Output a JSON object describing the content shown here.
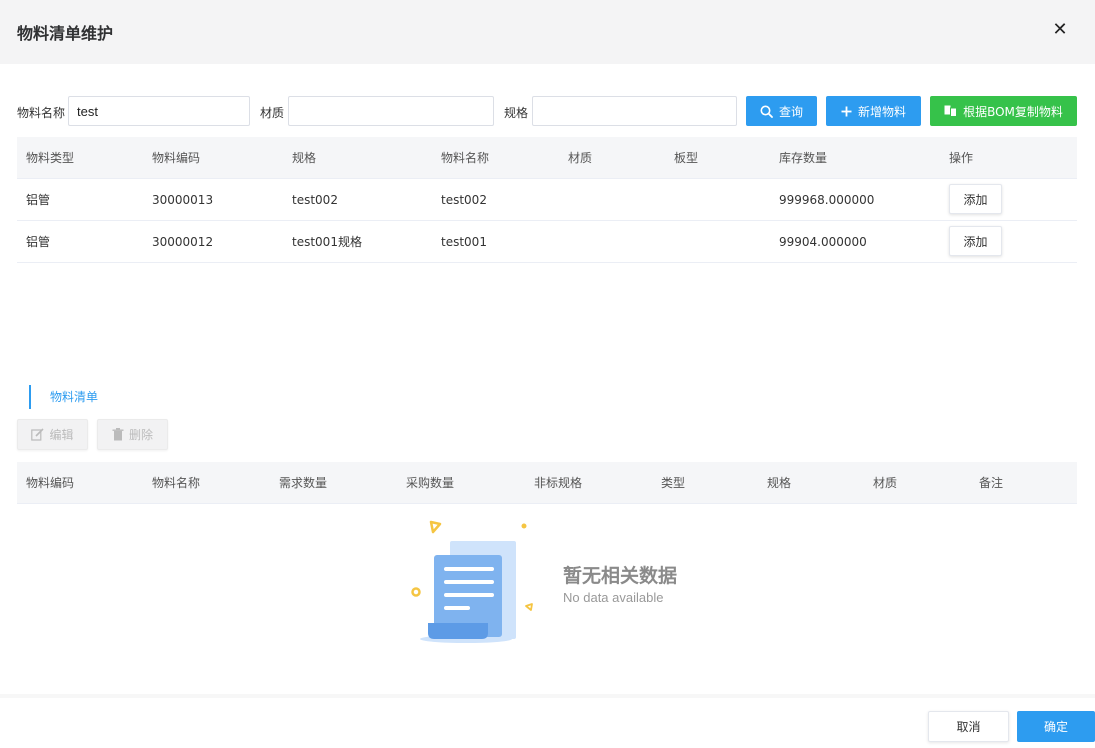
{
  "dialog": {
    "title": "物料清单维护",
    "close_icon": "close-icon"
  },
  "filters": {
    "name_label": "物料名称",
    "name_value": "test",
    "material_label": "材质",
    "material_value": "",
    "spec_label": "规格",
    "spec_value": ""
  },
  "buttons": {
    "search": "查询",
    "add_material": "新增物料",
    "copy_bom": "根据BOM复制物料"
  },
  "material_table": {
    "headers": [
      "物料类型",
      "物料编码",
      "规格",
      "物料名称",
      "材质",
      "板型",
      "库存数量",
      "操作"
    ],
    "rows": [
      {
        "type": "铝管",
        "code": "30000013",
        "spec": "test002",
        "name": "test002",
        "material": "",
        "board": "",
        "stock": "999968.000000",
        "action": "添加"
      },
      {
        "type": "铝管",
        "code": "30000012",
        "spec": "test001规格",
        "name": "test001",
        "material": "",
        "board": "",
        "stock": "99904.000000",
        "action": "添加"
      }
    ]
  },
  "bom_section": {
    "title": "物料清单",
    "edit": "编辑",
    "delete": "删除"
  },
  "bom_table": {
    "headers": [
      "物料编码",
      "物料名称",
      "需求数量",
      "采购数量",
      "非标规格",
      "类型",
      "规格",
      "材质",
      "备注"
    ]
  },
  "empty": {
    "title": "暂无相关数据",
    "subtitle": "No data available"
  },
  "footer": {
    "cancel": "取消",
    "ok": "确定"
  },
  "colors": {
    "primary": "#2d9cf0",
    "success": "#36c24a",
    "header_bg": "#f4f4f5",
    "table_head_bg": "#f5f6f8"
  }
}
